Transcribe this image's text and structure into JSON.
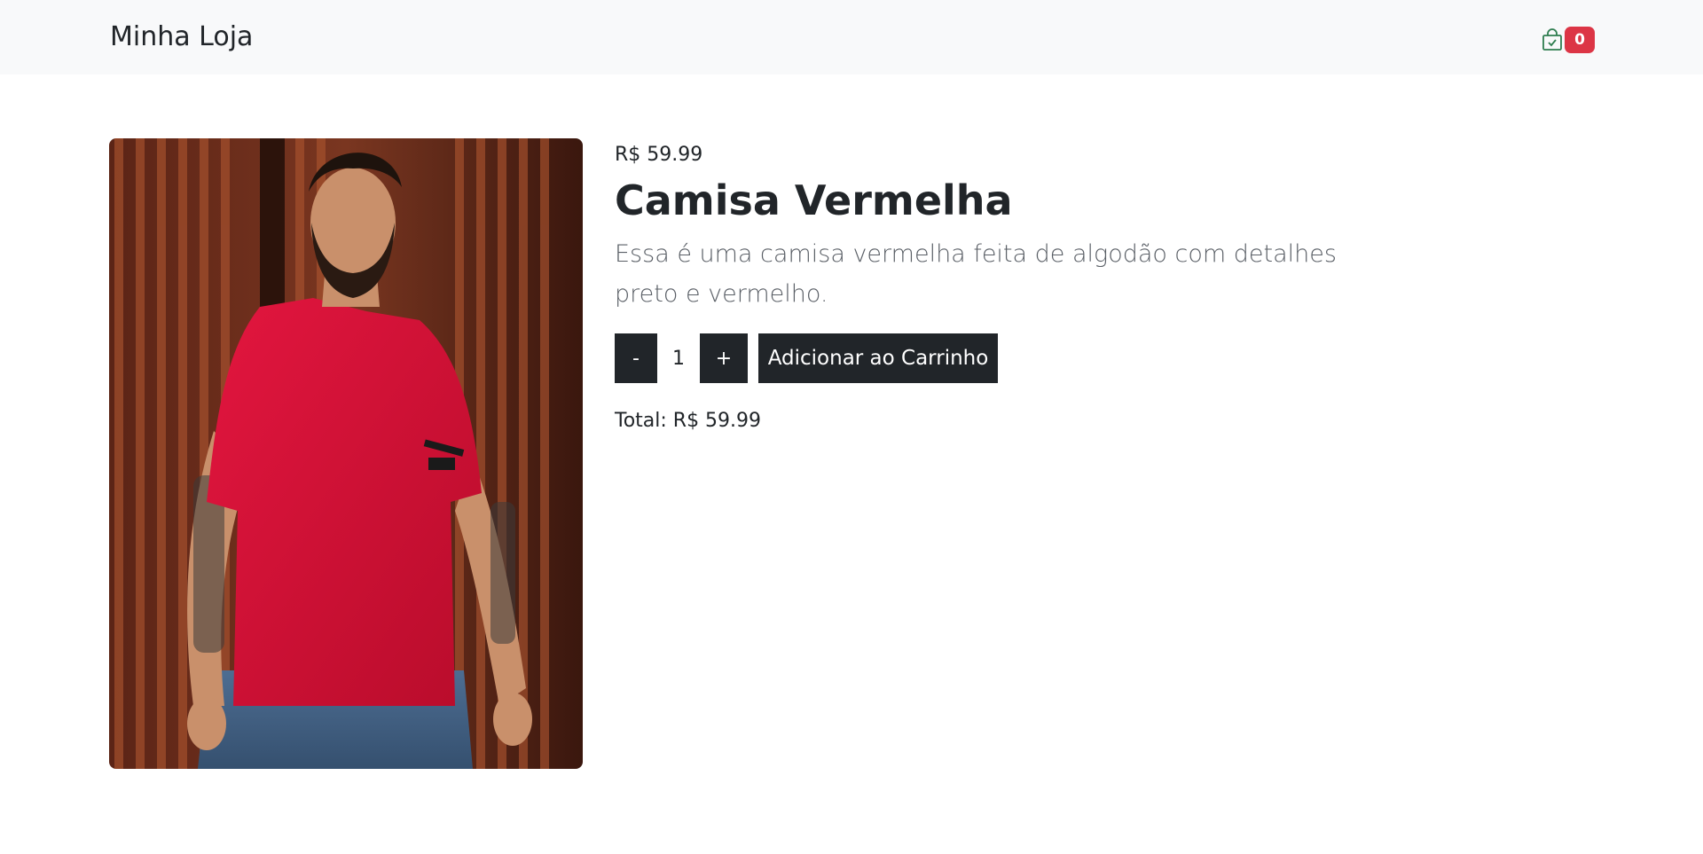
{
  "navbar": {
    "brand": "Minha Loja",
    "cart_icon": "shopping-bag-check-icon",
    "cart_count": "0",
    "badge_color": "#dc3545"
  },
  "product": {
    "image_alt": "Camisa Vermelha",
    "price": "R$ 59.99",
    "title": "Camisa Vermelha",
    "description": "Essa é uma camisa vermelha feita de algodão com detalhes preto e vermelho."
  },
  "quantity": {
    "minus_label": "-",
    "value": "1",
    "plus_label": "+"
  },
  "actions": {
    "add_to_cart_label": "Adicionar ao Carrinho"
  },
  "summary": {
    "total_text": "Total: R$ 59.99"
  },
  "colors": {
    "navbar_bg": "#f8f9fa",
    "button_dark": "#212529",
    "text": "#212529",
    "muted": "#5a5f66",
    "product_red": "#d80f35"
  }
}
